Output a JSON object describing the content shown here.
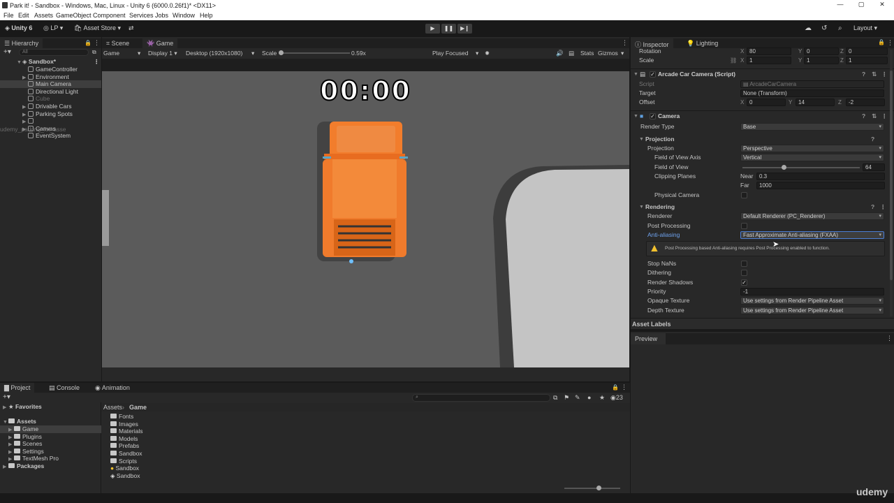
{
  "window": {
    "title": "Park it! - Sandbox - Windows, Mac, Linux - Unity 6 (6000.0.26f1)* <DX11>"
  },
  "menu": [
    "File",
    "Edit",
    "Assets",
    "GameObject",
    "Component",
    "Services",
    "Jobs",
    "Window",
    "Help"
  ],
  "toolbar": {
    "unity": "Unity 6",
    "account": "LP",
    "asset_store": "Asset Store",
    "layout": "Layout"
  },
  "hierarchy": {
    "tab": "Hierarchy",
    "search_placeholder": "All",
    "scene": "Sandbox*",
    "items": [
      {
        "label": "GameController",
        "selected": false,
        "dim": false,
        "expandable": false
      },
      {
        "label": "Environment",
        "selected": false,
        "dim": false,
        "expandable": true
      },
      {
        "label": "Main Camera",
        "selected": true,
        "dim": false,
        "expandable": false
      },
      {
        "label": "Directional Light",
        "selected": false,
        "dim": false,
        "expandable": false
      },
      {
        "label": "Cube",
        "selected": false,
        "dim": true,
        "expandable": false
      },
      {
        "label": "Drivable Cars",
        "selected": false,
        "dim": false,
        "expandable": true
      },
      {
        "label": "Parking Spots",
        "selected": false,
        "dim": false,
        "expandable": true
      },
      {
        "label": "udemy_parking_lot_asse",
        "selected": false,
        "dim": true,
        "expandable": true
      },
      {
        "label": "Canvas",
        "selected": false,
        "dim": false,
        "expandable": true
      },
      {
        "label": "EventSystem",
        "selected": false,
        "dim": false,
        "expandable": false
      }
    ]
  },
  "game_view": {
    "tabs": [
      "Scene",
      "Game"
    ],
    "mode": "Game",
    "display": "Display 1",
    "resolution": "Desktop (1920x1080)",
    "scale_label": "Scale",
    "scale_value": "0.59x",
    "play_focused": "Play Focused",
    "stats": "Stats",
    "gizmos": "Gizmos",
    "timer": "00:00"
  },
  "inspector": {
    "tabs": [
      "Inspector",
      "Lighting"
    ],
    "rotation": {
      "label": "Rotation",
      "x": "80",
      "y": "0",
      "z": "0"
    },
    "scale": {
      "label": "Scale",
      "x": "1",
      "y": "1",
      "z": "1"
    },
    "arcade": {
      "title": "Arcade Car Camera (Script)",
      "script_label": "Script",
      "script_value": "ArcadeCarCamera",
      "target_label": "Target",
      "target_value": "None (Transform)",
      "offset_label": "Offset",
      "offset_x": "0",
      "offset_y": "14",
      "offset_z": "-2"
    },
    "camera": {
      "title": "Camera",
      "render_type_label": "Render Type",
      "render_type": "Base",
      "projection_header": "Projection",
      "projection_label": "Projection",
      "projection": "Perspective",
      "fov_axis_label": "Field of View Axis",
      "fov_axis": "Vertical",
      "fov_label": "Field of View",
      "fov": "64",
      "fov_fraction": 0.35,
      "clipping_label": "Clipping Planes",
      "near_label": "Near",
      "near": "0.3",
      "far_label": "Far",
      "far": "1000",
      "physical_label": "Physical Camera",
      "rendering_header": "Rendering",
      "renderer_label": "Renderer",
      "renderer": "Default Renderer (PC_Renderer)",
      "post_label": "Post Processing",
      "aa_label": "Anti-aliasing",
      "aa": "Fast Approximate Anti-aliasing (FXAA)",
      "warning": "Post Processing based Anti-aliasing requires Post Processing enabled to function.",
      "stop_nans_label": "Stop NaNs",
      "dithering_label": "Dithering",
      "shadows_label": "Render Shadows",
      "priority_label": "Priority",
      "priority": "-1",
      "opaque_label": "Opaque Texture",
      "opaque": "Use settings from Render Pipeline Asset",
      "depth_label": "Depth Texture",
      "depth": "Use settings from Render Pipeline Asset"
    },
    "asset_labels": "Asset Labels",
    "preview": "Preview"
  },
  "bottom": {
    "tabs": [
      "Project",
      "Console",
      "Animation"
    ],
    "favorites": "Favorites",
    "assets": "Assets",
    "tree": [
      "Game",
      "Plugins",
      "Scenes",
      "Settings",
      "TextMesh Pro"
    ],
    "packages": "Packages",
    "breadcrumb_root": "Assets",
    "breadcrumb_current": "Game",
    "count": "23",
    "files": [
      "Fonts",
      "Images",
      "Materials",
      "Models",
      "Prefabs",
      "Sandbox",
      "Scripts",
      "Sandbox",
      "Sandbox"
    ]
  },
  "watermark": "udemy",
  "colors": {
    "accent": "#4c7fd6",
    "car": "#f07b2c",
    "warning": "#f2c12e"
  }
}
